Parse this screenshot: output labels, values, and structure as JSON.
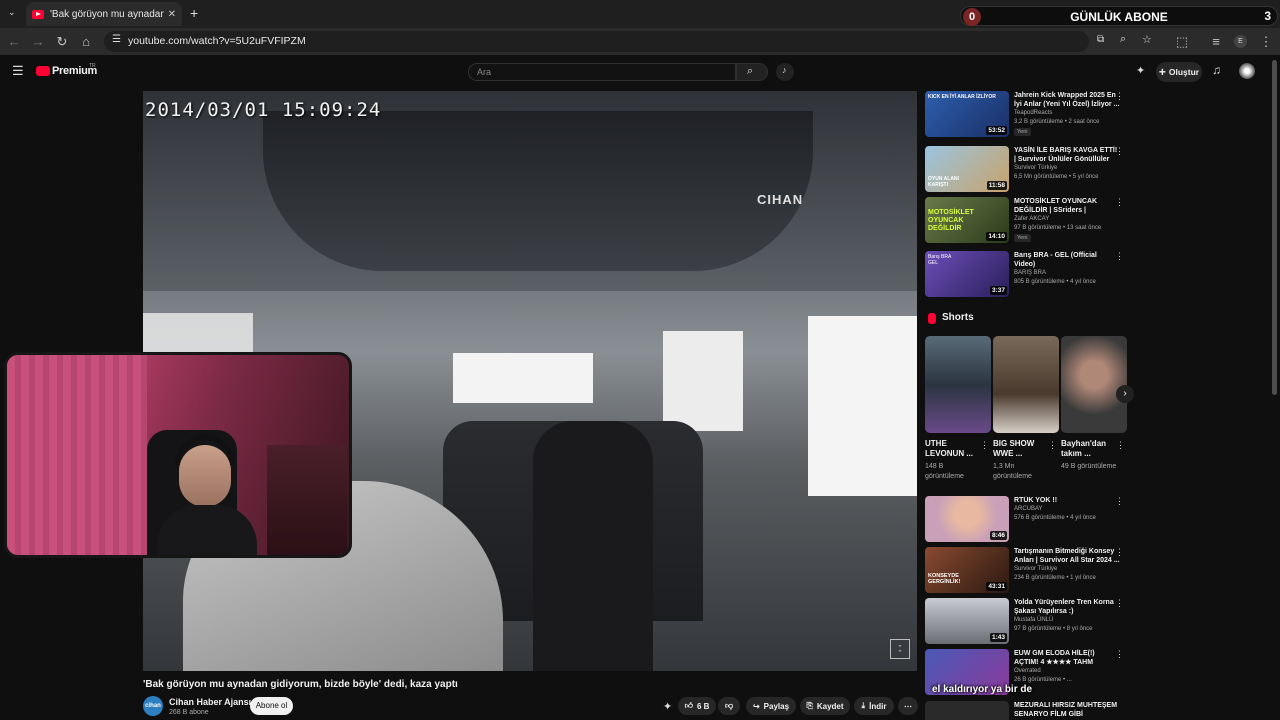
{
  "browser": {
    "tab_title": "'Bak görüyon mu aynadan gidiyorum'...",
    "url": "youtube.com/watch?v=5U2uFVFIPZM"
  },
  "stream_overlay": {
    "left_count": "0",
    "label": "GÜNLÜK ABONE",
    "right_count": "3"
  },
  "header": {
    "logo_text": "Premium",
    "logo_region": "TR",
    "search_placeholder": "Ara",
    "create_label": "Oluştur"
  },
  "video": {
    "timestamp": "2014/03/01  15:09:24",
    "watermark": "CIHAN",
    "title": "'Bak görüyon mu aynadan gidiyorum, bizde böyle' dedi, kaza yaptı",
    "channel_name": "Cihan Haber Ajansı",
    "channel_subs": "268 B abone",
    "avatar_text": "cihan",
    "subscribe_label": "Abone ol",
    "like_count": "6 B",
    "share_label": "Paylaş",
    "save_label": "Kaydet",
    "download_label": "İndir"
  },
  "sidebar": {
    "shorts_heading": "Shorts",
    "recommendations_top": [
      {
        "title": "Jahrein Kick Wrapped 2025 En İyi Anlar (Yeni Yıl Özel) İzliyor ...",
        "channel": "TeapodReacts",
        "meta": "3,2 B görüntüleme • 2 saat önce",
        "badge": "Yeni",
        "duration": "53:52",
        "thumb_text": "KICK EN İYİ ANLAR İZLİYOR",
        "thumb_color": "#2e5fae"
      },
      {
        "title": "YASİN İLE BARIŞ KAVGA ETTİ! | Survivor Ünlüler Gönüllüler",
        "channel": "Survivor Türkiye",
        "meta": "6,5 Mn görüntüleme • 5 yıl önce",
        "badge": "",
        "duration": "11:58",
        "thumb_text": "OYUN ALANI KARIŞTI",
        "thumb_color": "#7fa8c8"
      },
      {
        "title": "MOTOSİKLET OYUNCAK DEĞİLDİR | SSriders | Motosikl...",
        "channel": "Zafer AKCAY",
        "meta": "97 B görüntüleme • 13 saat önce",
        "badge": "Yeni",
        "duration": "14:10",
        "thumb_text": "MOTOSİKLET OYUNCAK DEĞİLDİR",
        "thumb_color": "#4a5a3a"
      },
      {
        "title": "Barış BRA - GEL (Official Video)",
        "channel": "BARIŞ BRA",
        "meta": "805 B görüntüleme • 4 yıl önce",
        "badge": "",
        "duration": "3:37",
        "thumb_text": "Barış BRA GEL",
        "thumb_color": "#5a3f9a"
      }
    ],
    "shorts": [
      {
        "title": "UTHE LEVONUN ...",
        "views": "148 B görüntüleme",
        "thumb_color": "#3c4d5a"
      },
      {
        "title": "BIG SHOW WWE ...",
        "views": "1,3 Mn görüntüleme",
        "thumb_color": "#5a4d3f"
      },
      {
        "title": "Bayhan'dan takım ...",
        "views": "49 B görüntüleme",
        "thumb_color": "#3a3a3a"
      }
    ],
    "recommendations_bottom": [
      {
        "title": "RTÜK YOK !!",
        "channel": "ARCUBAY",
        "meta": "576 B görüntüleme • 4 yıl önce",
        "duration": "8:46",
        "thumb_color": "#c9a0b8"
      },
      {
        "title": "Tartışmanın Bitmediği Konsey Anları | Survivor All Star 2024 ...",
        "channel": "Survivor Türkiye",
        "meta": "234 B görüntüleme • 1 yıl önce",
        "duration": "43:31",
        "thumb_text": "KONSEYDE GERGİNLİK!",
        "thumb_color": "#6b3a2a"
      },
      {
        "title": "Yolda Yürüyenlere Tren Korna Şakası Yapılırsa :)",
        "channel": "Mustafa ÜNLÜ",
        "meta": "97 B görüntüleme • 8 yıl önce",
        "duration": "1:43",
        "thumb_color": "#9aa3ad"
      },
      {
        "title": "EUW GM ELODA HİLE(!) AÇTIM! 4 ★★★★ TAHM KENCH?! ...",
        "channel": "Overrated",
        "meta": "26 B görüntüleme • ...",
        "duration": "",
        "thumb_color": "#3f4a8a"
      },
      {
        "title": "MEZURALI HIRSIZ MUHTEŞEM SENARYO FİLM GİBİ",
        "channel": "",
        "meta": "",
        "duration": "",
        "thumb_color": "#2a2a2a"
      }
    ]
  },
  "chat_overlay": "el kaldırıyor ya bir de"
}
